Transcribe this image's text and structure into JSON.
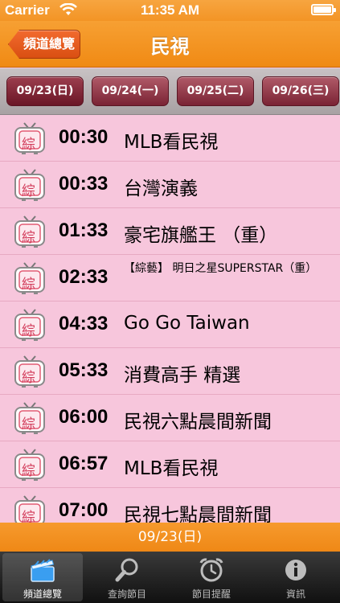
{
  "status_bar": {
    "carrier": "Carrier",
    "time": "11:35 AM"
  },
  "nav": {
    "back_label": "頻道總覽",
    "title": "民視"
  },
  "date_tabs": [
    "09/23(日)",
    "09/24(一)",
    "09/25(二)",
    "09/26(三)"
  ],
  "genre_label": "綜",
  "programs": [
    {
      "time": "00:30",
      "title": "MLB看民視"
    },
    {
      "time": "00:33",
      "title": "台灣演義"
    },
    {
      "time": "01:33",
      "title": "豪宅旗艦王 （重）"
    },
    {
      "time": "02:33",
      "title": "【綜藝】 明日之星SUPERSTAR（重）"
    },
    {
      "time": "04:33",
      "title": "Go Go Taiwan"
    },
    {
      "time": "05:33",
      "title": "消費高手 精選"
    },
    {
      "time": "06:00",
      "title": "民視六點晨間新聞"
    },
    {
      "time": "06:57",
      "title": "MLB看民視"
    },
    {
      "time": "07:00",
      "title": "民視七點晨間新聞"
    }
  ],
  "footer_date": "09/23(日)",
  "tabs": [
    {
      "label": "頻道總覽",
      "icon": "clapperboard-icon"
    },
    {
      "label": "查詢節目",
      "icon": "search-icon"
    },
    {
      "label": "節目提醒",
      "icon": "alarm-clock-icon"
    },
    {
      "label": "資訊",
      "icon": "info-icon"
    }
  ],
  "colors": {
    "accent": "#f08a14",
    "list_bg": "#f7c6dc",
    "date_tab": "#7a2334"
  }
}
